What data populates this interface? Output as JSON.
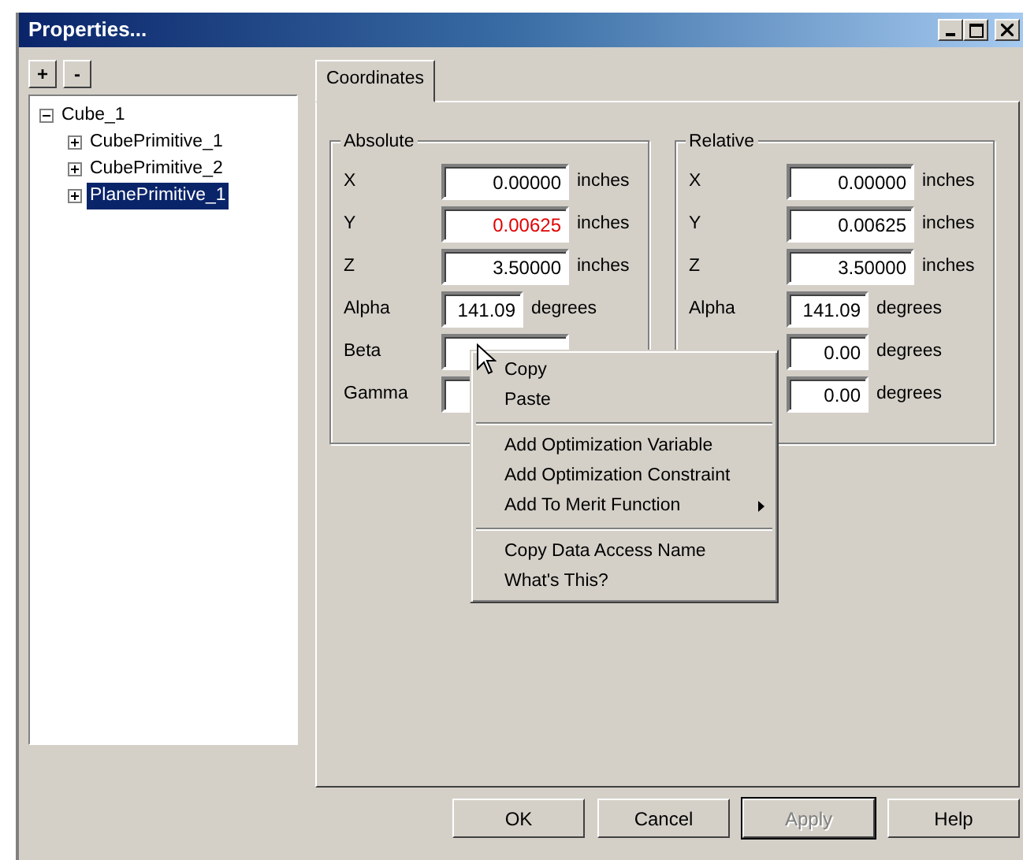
{
  "window": {
    "title": "Properties..."
  },
  "tree_buttons": [
    "+",
    "-"
  ],
  "tree": [
    {
      "label": "Cube_1",
      "expanded": true,
      "selected": false,
      "children": [
        {
          "label": "CubePrimitive_1",
          "expanded": false,
          "selected": false
        },
        {
          "label": "CubePrimitive_2",
          "expanded": false,
          "selected": false
        },
        {
          "label": "PlanePrimitive_1",
          "expanded": false,
          "selected": true
        }
      ]
    }
  ],
  "tabs": [
    {
      "label": "Coordinates",
      "selected": true
    }
  ],
  "groups": [
    {
      "title": "Absolute",
      "rows": [
        {
          "label": "X",
          "value": "0.00000",
          "unit": "inches",
          "modified": false,
          "kind": "wide"
        },
        {
          "label": "Y",
          "value": "0.00625",
          "unit": "inches",
          "modified": true,
          "kind": "wide"
        },
        {
          "label": "Z",
          "value": "3.50000",
          "unit": "inches",
          "modified": false,
          "kind": "wide"
        },
        {
          "label": "Alpha",
          "value": "141.09",
          "unit": "degrees",
          "modified": false,
          "kind": "narrow"
        },
        {
          "label": "Beta",
          "modified": false,
          "kind": "wide"
        },
        {
          "label": "Gamma",
          "modified": false,
          "kind": "wide"
        }
      ]
    },
    {
      "title": "Relative",
      "rows": [
        {
          "label": "X",
          "value": "0.00000",
          "unit": "inches",
          "modified": false,
          "kind": "wide"
        },
        {
          "label": "Y",
          "value": "0.00625",
          "unit": "inches",
          "modified": false,
          "kind": "wide"
        },
        {
          "label": "Z",
          "value": "3.50000",
          "unit": "inches",
          "modified": false,
          "kind": "wide"
        },
        {
          "label": "Alpha",
          "value": "141.09",
          "unit": "degrees",
          "modified": false,
          "kind": "narrow"
        },
        {
          "value": "0.00",
          "unit": "degrees",
          "modified": false,
          "kind": "narrow"
        },
        {
          "value": "0.00",
          "unit": "degrees",
          "modified": false,
          "kind": "narrow"
        }
      ]
    }
  ],
  "context_menu": [
    {
      "kind": "item",
      "label": "Copy",
      "submenu": false
    },
    {
      "kind": "item",
      "label": "Paste",
      "submenu": false
    },
    {
      "kind": "separator"
    },
    {
      "kind": "item",
      "label": "Add Optimization Variable",
      "submenu": false
    },
    {
      "kind": "item",
      "label": "Add Optimization Constraint",
      "submenu": false
    },
    {
      "kind": "item",
      "label": "Add To Merit Function",
      "submenu": true
    },
    {
      "kind": "separator"
    },
    {
      "kind": "item",
      "label": "Copy Data Access Name",
      "submenu": false
    },
    {
      "kind": "item",
      "label": "What's This?",
      "submenu": false
    }
  ],
  "buttons": [
    {
      "label": "OK",
      "disabled": false,
      "default": false
    },
    {
      "label": "Cancel",
      "disabled": false,
      "default": false
    },
    {
      "label": "Apply",
      "disabled": true,
      "default": true
    },
    {
      "label": "Help",
      "disabled": false,
      "default": false
    }
  ]
}
